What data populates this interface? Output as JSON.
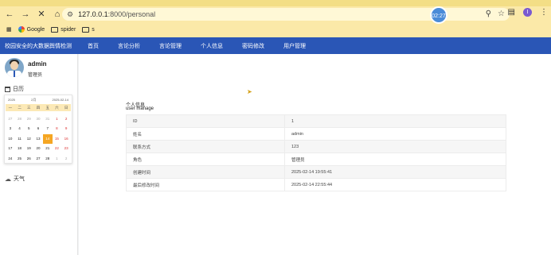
{
  "browser": {
    "url_host": "127.0.0.1",
    "url_path": ":8000/personal",
    "timer": "02:27",
    "profile_initial": "I",
    "bookmarks": [
      "Google",
      "spider",
      "s"
    ]
  },
  "app": {
    "title": "校园安全的大数据舆情检测",
    "menu": [
      "首页",
      "言论分析",
      "言论管理",
      "个人信息",
      "密码修改",
      "用户管理"
    ]
  },
  "sidebar": {
    "user_name": "admin",
    "user_role": "管理员",
    "calendar_label": "日历",
    "weather_label": "天气",
    "calendar": {
      "year": "2025",
      "month": "2月",
      "today_label": "2025-02-14",
      "weekdays": [
        "一",
        "二",
        "三",
        "四",
        "五",
        "六",
        "日"
      ],
      "days": [
        {
          "d": "27",
          "out": true
        },
        {
          "d": "28",
          "out": true
        },
        {
          "d": "29",
          "out": true
        },
        {
          "d": "30",
          "out": true
        },
        {
          "d": "31",
          "out": true
        },
        {
          "d": "1",
          "wk": true
        },
        {
          "d": "2",
          "wk": true
        },
        {
          "d": "3"
        },
        {
          "d": "4"
        },
        {
          "d": "5"
        },
        {
          "d": "6"
        },
        {
          "d": "7"
        },
        {
          "d": "8",
          "wk": true
        },
        {
          "d": "9",
          "wk": true
        },
        {
          "d": "10"
        },
        {
          "d": "11"
        },
        {
          "d": "12"
        },
        {
          "d": "13"
        },
        {
          "d": "14",
          "today": true
        },
        {
          "d": "15",
          "wk": true
        },
        {
          "d": "16",
          "wk": true
        },
        {
          "d": "17"
        },
        {
          "d": "18"
        },
        {
          "d": "19"
        },
        {
          "d": "20"
        },
        {
          "d": "21"
        },
        {
          "d": "22",
          "wk": true
        },
        {
          "d": "23",
          "wk": true
        },
        {
          "d": "24"
        },
        {
          "d": "25"
        },
        {
          "d": "26"
        },
        {
          "d": "27"
        },
        {
          "d": "28"
        },
        {
          "d": "1",
          "out": true
        },
        {
          "d": "2",
          "out": true
        }
      ]
    }
  },
  "personal": {
    "title": "个人信息",
    "subtitle": "user manage",
    "rows": [
      {
        "label": "ID",
        "value": "1"
      },
      {
        "label": "姓名",
        "value": "admin"
      },
      {
        "label": "联系方式",
        "value": "123"
      },
      {
        "label": "角色",
        "value": "管理员"
      },
      {
        "label": "创建时间",
        "value": "2025-02-14 19:55:41"
      },
      {
        "label": "最后修改时间",
        "value": "2025-02-14 22:55:44"
      }
    ]
  },
  "colors": {
    "chrome": "#fbe9a8",
    "header": "#2a56b6",
    "today": "#f5a623"
  }
}
